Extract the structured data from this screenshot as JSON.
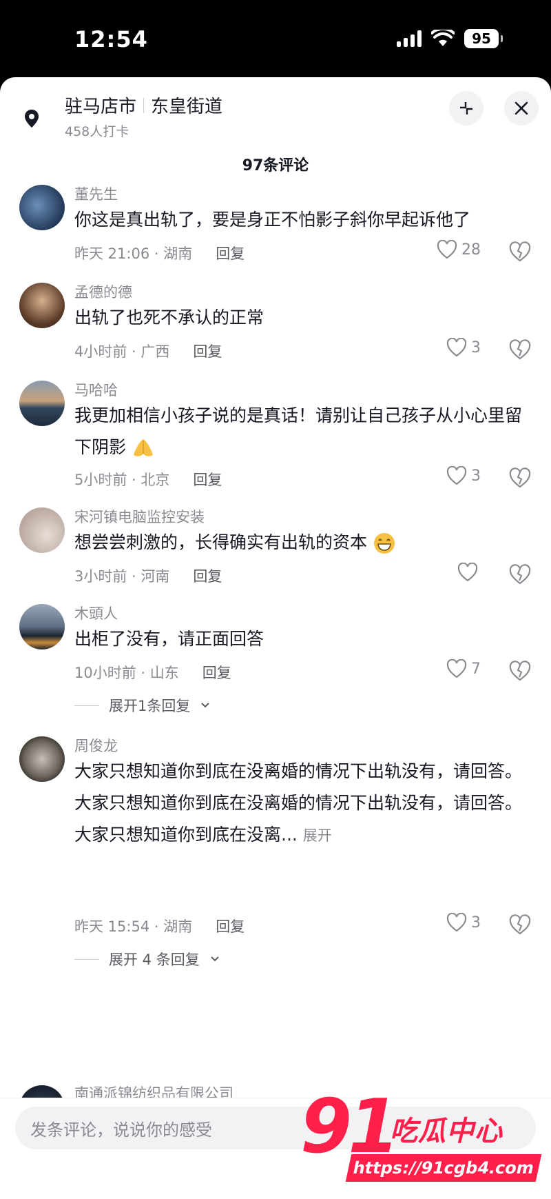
{
  "status_bar": {
    "time": "12:54",
    "battery": "95"
  },
  "location": {
    "title": "驻马店市",
    "subtitle": "东皇街道",
    "checkins": "458人打卡"
  },
  "comments_header": {
    "count_label": "97条评论"
  },
  "comments": [
    {
      "name": "董先生",
      "text": "你这是真出轨了，要是身正不怕影子斜你早起诉他了",
      "meta": "昨天 21:06 · 湖南",
      "reply": "回复",
      "likes": "28"
    },
    {
      "name": "孟德的德",
      "text": "出轨了也死不承认的正常",
      "meta": "4小时前 · 广西",
      "reply": "回复",
      "likes": "3"
    },
    {
      "name": "马哈哈",
      "text": "我更加相信小孩子说的是真话！请别让自己孩子从小心里留下阴影",
      "meta": "5小时前 · 北京",
      "reply": "回复",
      "likes": "3"
    },
    {
      "name": "宋河镇电脑监控安装",
      "text": "想尝尝刺激的，长得确实有出轨的资本",
      "meta": "3小时前 · 河南",
      "reply": "回复",
      "likes": ""
    },
    {
      "name": "木頭人",
      "text": "出柜了没有，请正面回答",
      "meta": "10小时前 · 山东",
      "reply": "回复",
      "likes": "7",
      "expand": "展开1条回复"
    },
    {
      "name": "周俊龙",
      "text_lines": [
        "大家只想知道你到底在没离婚的情况下出轨没有，请回答。",
        "大家只想知道你到底在没离婚的情况下出轨没有，请回答。",
        "大家只想知道你到底在没离..."
      ],
      "more": "展开",
      "meta": "昨天 15:54 · 湖南",
      "reply": "回复",
      "likes": "3",
      "expand": "展开 4 条回复"
    },
    {
      "name": "南通派锦纺织品有限公司"
    }
  ],
  "input": {
    "placeholder": "发条评论，说说你的感受"
  },
  "watermark": {
    "number": "91",
    "brand": "吃瓜中心",
    "url": "https://91cgb4.com"
  },
  "colors": {
    "accent": "#ff1f4b",
    "text": "#161823",
    "muted": "#8a8b91"
  },
  "icons": [
    "location-pin-icon",
    "collapse-icon",
    "close-icon",
    "heart-icon",
    "broken-heart-icon",
    "image-icon",
    "at-icon",
    "emoji-icon"
  ]
}
